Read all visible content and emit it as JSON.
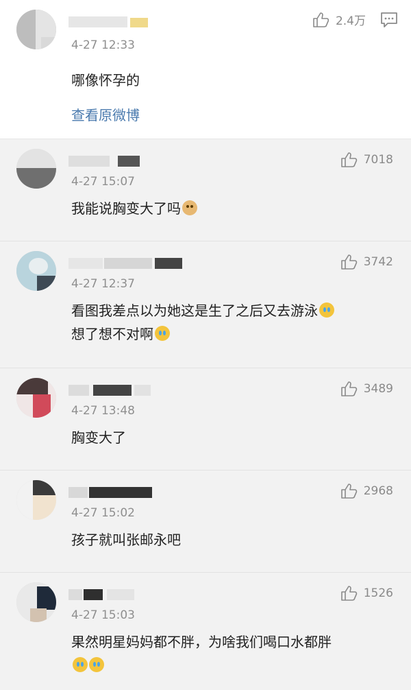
{
  "top_comment": {
    "time": "4-27 12:33",
    "text": "哪像怀孕的",
    "likes": "2.4万",
    "view_original": "查看原微博",
    "like_icon": "thumbs-up-icon",
    "reply_icon": "comment-icon"
  },
  "comments": [
    {
      "time": "4-27 15:07",
      "likes": "7018",
      "text": "我能说胸变大了吗",
      "emoji": "dog-emoji"
    },
    {
      "time": "4-27 12:37",
      "likes": "3742",
      "text": "看图我差点以为她这是生了之后又去游泳",
      "text2": "想了想不对啊",
      "emoji": "laugh-cry-emoji"
    },
    {
      "time": "4-27 13:48",
      "likes": "3489",
      "text": "胸变大了"
    },
    {
      "time": "4-27 15:02",
      "likes": "2968",
      "text": "孩子就叫张邮永吧"
    },
    {
      "time": "4-27 15:03",
      "likes": "1526",
      "text": "果然明星妈妈都不胖，为啥我们喝口水都胖",
      "emoji": "crying-emoji"
    }
  ],
  "colors": {
    "link": "#4a7aae",
    "meta": "#8f8f8f",
    "background": "#f2f2f2"
  }
}
